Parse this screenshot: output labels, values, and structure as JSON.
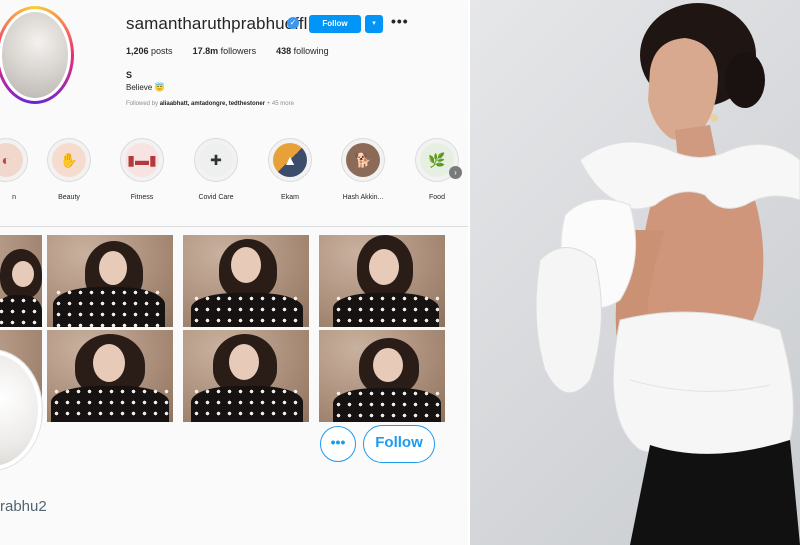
{
  "profile": {
    "username": "samantharuthprabhuoffl",
    "verified_icon": "verified-badge-icon",
    "follow_label": "Follow",
    "dropdown_icon": "chevron-down-icon",
    "more_icon": "ellipsis-icon",
    "stats": {
      "posts": "1,206",
      "posts_label": "posts",
      "followers": "17.8m",
      "followers_label": "followers",
      "following": "438",
      "following_label": "following"
    },
    "bio_name": "S",
    "bio_text": "Believe 😇",
    "followed_by_prefix": "Followed by",
    "followed_by_names": "aliaabhatt, amtadongre, tedthestoner",
    "followed_by_suffix": "+ 45 more"
  },
  "highlights": [
    {
      "label": "n",
      "icon": "highlight-partial-icon"
    },
    {
      "label": "Beauty",
      "icon": "beauty-icon"
    },
    {
      "label": "Fitness",
      "icon": "dumbbell-icon"
    },
    {
      "label": "Covid Care",
      "icon": "medical-kit-icon"
    },
    {
      "label": "Ekam",
      "icon": "ekam-icon"
    },
    {
      "label": "Hash Akkin...",
      "icon": "dog-icon"
    },
    {
      "label": "Food",
      "icon": "plant-icon"
    }
  ],
  "highlights_next_icon": "chevron-right-icon",
  "tweet_card": {
    "options_label": "•••",
    "follow_label": "Follow",
    "handle": "rabhu2"
  },
  "colors": {
    "instagram_blue": "#0095f6",
    "twitter_blue": "#1d9bf0"
  }
}
